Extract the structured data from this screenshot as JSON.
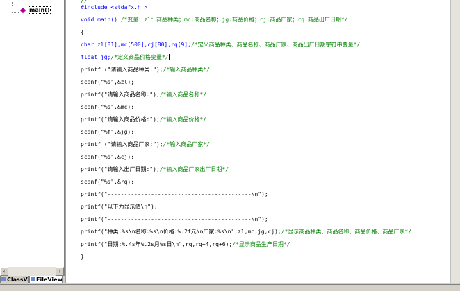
{
  "workspace": {
    "tree": {
      "root_label": "",
      "function_item": "main()"
    },
    "scroll_left_glyph": "‹",
    "scroll_right_glyph": "›",
    "tabs": [
      {
        "label": "ClassV..."
      },
      {
        "label": "FileView"
      }
    ]
  },
  "editor": {
    "lines": [
      {
        "code": "//",
        "comment": ""
      },
      {
        "code": "#include <stdafx.h >",
        "comment": ""
      },
      {
        "code": "void main() ",
        "comment": "/*变量：zl：商品种类；mc:商品名称；jg:商品价格；cj:商品厂家；rq:商品出厂日期*/"
      },
      {
        "code": "{",
        "comment": ""
      },
      {
        "code": "char zl[81],mc[500],cj[80],rq[9];",
        "comment": "/*定义商品种类、商品名称、商品厂家、商品出厂日期字符串变量*/"
      },
      {
        "code": "float jg;",
        "comment": "/*定义商品价格变量*/"
      },
      {
        "code": "printf (\"请输入商品种类:\");",
        "comment": "/*输入商品种类*/"
      },
      {
        "code": "scanf(\"%s\",&zl);",
        "comment": ""
      },
      {
        "code": "printf(\"请输入商品名称:\");",
        "comment": "/*输入商品名称*/"
      },
      {
        "code": "scanf(\"%s\",&mc);",
        "comment": ""
      },
      {
        "code": "printf(\"请输入商品价格:\");",
        "comment": "/*输入商品价格*/"
      },
      {
        "code": "scanf(\"%f\",&jg);",
        "comment": ""
      },
      {
        "code": "printf (\"请输入商品厂家:\");",
        "comment": "/*输入商品厂家*/"
      },
      {
        "code": "scanf(\"%s\",&cj);",
        "comment": ""
      },
      {
        "code": "printf(\"请输入出厂日期:\");",
        "comment": "/*输入商品厂家出厂日期*/"
      },
      {
        "code": "scanf(\"%s\",&rq);",
        "comment": ""
      },
      {
        "code": "printf(\"-------------------------------------------\\n\");",
        "comment": ""
      },
      {
        "code": "printf(\"以下为显示值\\n\");",
        "comment": ""
      },
      {
        "code": "printf(\"-------------------------------------------\\n\");",
        "comment": ""
      },
      {
        "code": "printf(\"种类:%s\\n名称:%s\\n价格:%.2f元\\n厂家:%s\\n\",zl,mc,jg,cj);",
        "comment": "/*显示商品种类、商品名称、商品价格、商品厂家*/"
      },
      {
        "code": "printf(\"日期:%.4s年%.2s月%s日\\n\",rq,rq+4,rq+6);",
        "comment": "/*显示商品生产日期*/"
      },
      {
        "code": "}",
        "comment": ""
      }
    ]
  },
  "colors": {
    "keyword": "#0000ff",
    "comment": "#008000",
    "text": "#000000"
  }
}
